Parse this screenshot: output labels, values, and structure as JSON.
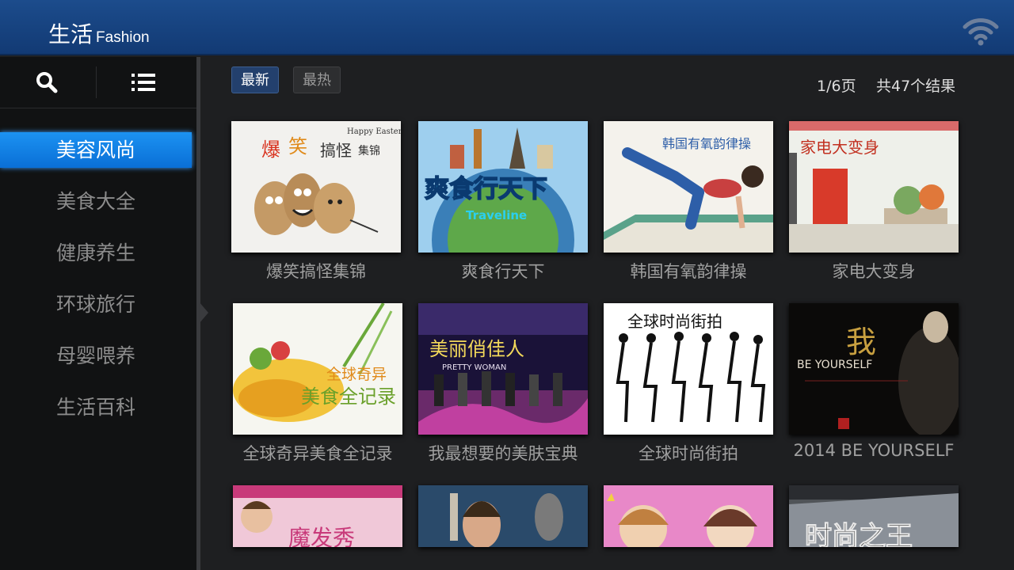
{
  "header": {
    "title": "生活",
    "subtitle": "Fashion",
    "wifi_icon": "wifi-icon"
  },
  "toolbar": {
    "search_icon": "search-icon",
    "list_icon": "list-icon"
  },
  "sidebar": {
    "items": [
      {
        "label": "美容风尚",
        "active": true
      },
      {
        "label": "美食大全",
        "active": false
      },
      {
        "label": "健康养生",
        "active": false
      },
      {
        "label": "环球旅行",
        "active": false
      },
      {
        "label": "母婴喂养",
        "active": false
      },
      {
        "label": "生活百科",
        "active": false
      }
    ]
  },
  "sort": {
    "newest": "最新",
    "hottest": "最热",
    "selected": "最新"
  },
  "pagination": {
    "page": "1/6页",
    "results": "共47个结果"
  },
  "grid": {
    "items": [
      {
        "title": "爆笑搞怪集锦",
        "thumb_text": [
          "爆",
          "笑",
          "搞怪",
          "集锦",
          "Happy Easter"
        ]
      },
      {
        "title": "爽食行天下",
        "thumb_text": [
          "爽食行天下",
          "Traveline"
        ]
      },
      {
        "title": "韩国有氧韵律操",
        "thumb_text": [
          "韩国有氧韵律操"
        ]
      },
      {
        "title": "家电大变身",
        "thumb_text": [
          "家电大变身"
        ]
      },
      {
        "title": "全球奇异美食全记录",
        "thumb_text": [
          "全球奇异",
          "美食全记录"
        ]
      },
      {
        "title": "我最想要的美肤宝典",
        "thumb_text": [
          "美丽俏佳人",
          "PRETTY WOMAN"
        ]
      },
      {
        "title": "全球时尚街拍",
        "thumb_text": [
          "全球时尚街拍"
        ]
      },
      {
        "title": "2014 BE YOURSELF",
        "thumb_text": [
          "我",
          "BE YOURSELF"
        ]
      },
      {
        "title": "",
        "thumb_text": [
          "魔发秀"
        ]
      },
      {
        "title": "",
        "thumb_text": []
      },
      {
        "title": "",
        "thumb_text": []
      },
      {
        "title": "",
        "thumb_text": [
          "时尚之王"
        ]
      }
    ]
  },
  "colors": {
    "header": "#1a4a8a",
    "active_item": "#1486ee",
    "background": "#1e1f21"
  }
}
